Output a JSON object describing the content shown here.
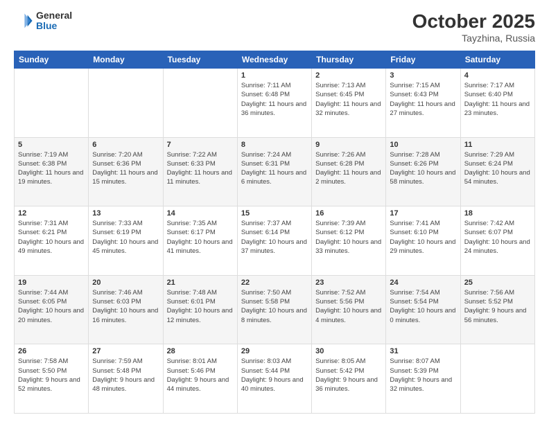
{
  "logo": {
    "general": "General",
    "blue": "Blue"
  },
  "header": {
    "month": "October 2025",
    "location": "Tayzhina, Russia"
  },
  "weekdays": [
    "Sunday",
    "Monday",
    "Tuesday",
    "Wednesday",
    "Thursday",
    "Friday",
    "Saturday"
  ],
  "weeks": [
    [
      {
        "day": "",
        "info": ""
      },
      {
        "day": "",
        "info": ""
      },
      {
        "day": "",
        "info": ""
      },
      {
        "day": "1",
        "info": "Sunrise: 7:11 AM\nSunset: 6:48 PM\nDaylight: 11 hours and 36 minutes."
      },
      {
        "day": "2",
        "info": "Sunrise: 7:13 AM\nSunset: 6:45 PM\nDaylight: 11 hours and 32 minutes."
      },
      {
        "day": "3",
        "info": "Sunrise: 7:15 AM\nSunset: 6:43 PM\nDaylight: 11 hours and 27 minutes."
      },
      {
        "day": "4",
        "info": "Sunrise: 7:17 AM\nSunset: 6:40 PM\nDaylight: 11 hours and 23 minutes."
      }
    ],
    [
      {
        "day": "5",
        "info": "Sunrise: 7:19 AM\nSunset: 6:38 PM\nDaylight: 11 hours and 19 minutes."
      },
      {
        "day": "6",
        "info": "Sunrise: 7:20 AM\nSunset: 6:36 PM\nDaylight: 11 hours and 15 minutes."
      },
      {
        "day": "7",
        "info": "Sunrise: 7:22 AM\nSunset: 6:33 PM\nDaylight: 11 hours and 11 minutes."
      },
      {
        "day": "8",
        "info": "Sunrise: 7:24 AM\nSunset: 6:31 PM\nDaylight: 11 hours and 6 minutes."
      },
      {
        "day": "9",
        "info": "Sunrise: 7:26 AM\nSunset: 6:28 PM\nDaylight: 11 hours and 2 minutes."
      },
      {
        "day": "10",
        "info": "Sunrise: 7:28 AM\nSunset: 6:26 PM\nDaylight: 10 hours and 58 minutes."
      },
      {
        "day": "11",
        "info": "Sunrise: 7:29 AM\nSunset: 6:24 PM\nDaylight: 10 hours and 54 minutes."
      }
    ],
    [
      {
        "day": "12",
        "info": "Sunrise: 7:31 AM\nSunset: 6:21 PM\nDaylight: 10 hours and 49 minutes."
      },
      {
        "day": "13",
        "info": "Sunrise: 7:33 AM\nSunset: 6:19 PM\nDaylight: 10 hours and 45 minutes."
      },
      {
        "day": "14",
        "info": "Sunrise: 7:35 AM\nSunset: 6:17 PM\nDaylight: 10 hours and 41 minutes."
      },
      {
        "day": "15",
        "info": "Sunrise: 7:37 AM\nSunset: 6:14 PM\nDaylight: 10 hours and 37 minutes."
      },
      {
        "day": "16",
        "info": "Sunrise: 7:39 AM\nSunset: 6:12 PM\nDaylight: 10 hours and 33 minutes."
      },
      {
        "day": "17",
        "info": "Sunrise: 7:41 AM\nSunset: 6:10 PM\nDaylight: 10 hours and 29 minutes."
      },
      {
        "day": "18",
        "info": "Sunrise: 7:42 AM\nSunset: 6:07 PM\nDaylight: 10 hours and 24 minutes."
      }
    ],
    [
      {
        "day": "19",
        "info": "Sunrise: 7:44 AM\nSunset: 6:05 PM\nDaylight: 10 hours and 20 minutes."
      },
      {
        "day": "20",
        "info": "Sunrise: 7:46 AM\nSunset: 6:03 PM\nDaylight: 10 hours and 16 minutes."
      },
      {
        "day": "21",
        "info": "Sunrise: 7:48 AM\nSunset: 6:01 PM\nDaylight: 10 hours and 12 minutes."
      },
      {
        "day": "22",
        "info": "Sunrise: 7:50 AM\nSunset: 5:58 PM\nDaylight: 10 hours and 8 minutes."
      },
      {
        "day": "23",
        "info": "Sunrise: 7:52 AM\nSunset: 5:56 PM\nDaylight: 10 hours and 4 minutes."
      },
      {
        "day": "24",
        "info": "Sunrise: 7:54 AM\nSunset: 5:54 PM\nDaylight: 10 hours and 0 minutes."
      },
      {
        "day": "25",
        "info": "Sunrise: 7:56 AM\nSunset: 5:52 PM\nDaylight: 9 hours and 56 minutes."
      }
    ],
    [
      {
        "day": "26",
        "info": "Sunrise: 7:58 AM\nSunset: 5:50 PM\nDaylight: 9 hours and 52 minutes."
      },
      {
        "day": "27",
        "info": "Sunrise: 7:59 AM\nSunset: 5:48 PM\nDaylight: 9 hours and 48 minutes."
      },
      {
        "day": "28",
        "info": "Sunrise: 8:01 AM\nSunset: 5:46 PM\nDaylight: 9 hours and 44 minutes."
      },
      {
        "day": "29",
        "info": "Sunrise: 8:03 AM\nSunset: 5:44 PM\nDaylight: 9 hours and 40 minutes."
      },
      {
        "day": "30",
        "info": "Sunrise: 8:05 AM\nSunset: 5:42 PM\nDaylight: 9 hours and 36 minutes."
      },
      {
        "day": "31",
        "info": "Sunrise: 8:07 AM\nSunset: 5:39 PM\nDaylight: 9 hours and 32 minutes."
      },
      {
        "day": "",
        "info": ""
      }
    ]
  ]
}
